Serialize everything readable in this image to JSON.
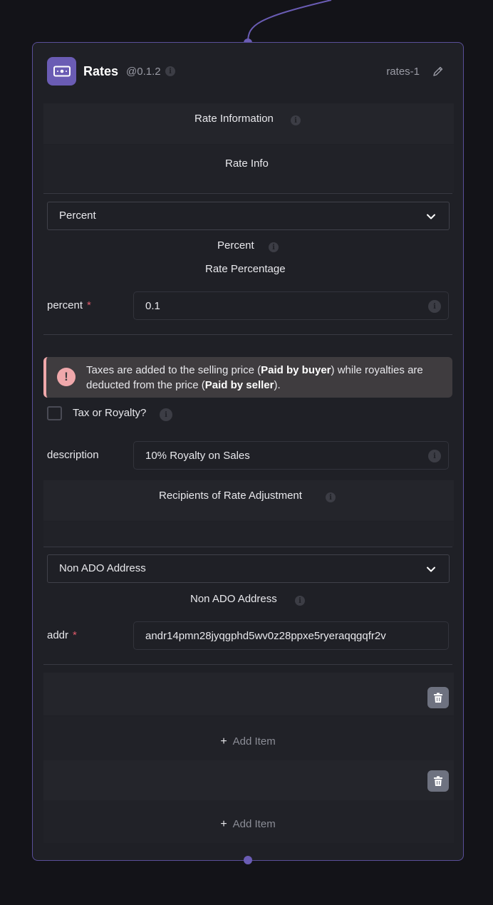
{
  "node": {
    "title": "Rates",
    "version": "@0.1.2",
    "id": "rates-1"
  },
  "sections": {
    "rate_information": "Rate Information",
    "rate_info": "Rate Info",
    "percent_heading": "Percent",
    "rate_percentage": "Rate Percentage",
    "recipients": "Recipients of Rate Adjustment",
    "non_ado_heading": "Non ADO Address"
  },
  "rate_type_select": {
    "value": "Percent"
  },
  "percent_field": {
    "label": "percent",
    "required_mark": "*",
    "value": "0.1"
  },
  "alert": {
    "text_1": "Taxes are added to the selling price (",
    "bold_1": "Paid by buyer",
    "text_2": ") while royalties are deducted from the price (",
    "bold_2": "Paid by seller",
    "text_3": ")."
  },
  "tax_checkbox": {
    "label": "Tax or Royalty?",
    "checked": false
  },
  "description_field": {
    "label": "description",
    "value": "10% Royalty on Sales"
  },
  "recipient_select": {
    "value": "Non ADO Address"
  },
  "addr_field": {
    "label": "addr",
    "required_mark": "*",
    "value": "andr14pmn28jyqgphd5wv0z28ppxe5ryeraqqgqfr2v"
  },
  "add_item_label_1": "Add Item",
  "add_item_label_2": "Add Item",
  "add_item_plus": "+",
  "colors": {
    "accent": "#6a5cb4",
    "card_bg": "#1f2026",
    "alert_bg": "#3f3c3f",
    "alert_icon": "#f0a8ab",
    "required": "#e05a6a"
  }
}
